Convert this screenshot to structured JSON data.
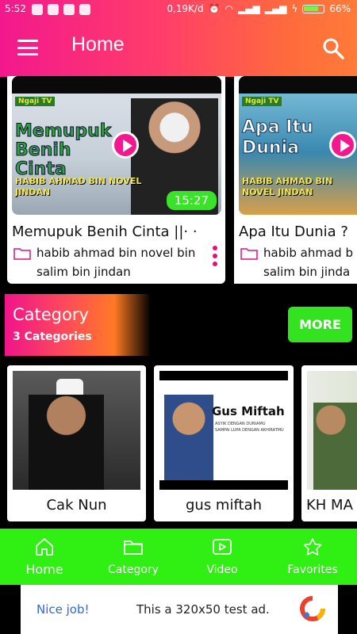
{
  "status_bar": {
    "time": "5:52",
    "net_speed": "0,19K/d",
    "battery": "66%"
  },
  "app_bar": {
    "title": "Home"
  },
  "videos": [
    {
      "thumb_text": "Memupuk Benih Cinta",
      "thumb_name": "HABIB AHMAD BIN NOVEL JINDAN",
      "duration": "15:27",
      "title": "Memupuk Benih Cinta ||· ·",
      "channel_line1": "habib ahmad bin novel bin",
      "channel_line2": "salim bin jindan",
      "brand": "Ngaji TV"
    },
    {
      "thumb_text": "Apa Itu Dunia",
      "thumb_name": "HABIB AHMAD BIN NOVEL JINDAN",
      "title": "Apa Itu Dunia ?",
      "channel_line1": "habib ahmad b",
      "channel_line2": "salim bin jinda",
      "brand": "Ngaji TV"
    }
  ],
  "category": {
    "title": "Category",
    "count": "3 Categories",
    "more": "MORE",
    "items": [
      {
        "label": "Cak Nun"
      },
      {
        "label": "gus miftah",
        "poster_title": "Gus Miftah",
        "poster_sub1": "ASYIK DENGAN DUNIAMU",
        "poster_sub2": "SAMPAI LUPA DENGAN AKHIRATMU"
      },
      {
        "label": "KH MA"
      }
    ]
  },
  "bottom_nav": [
    {
      "label": "Home"
    },
    {
      "label": "Category"
    },
    {
      "label": "Video"
    },
    {
      "label": "Favorites"
    }
  ],
  "ad": {
    "nice_job": "Nice job!",
    "text": "This a 320x50 test ad."
  },
  "colors": {
    "accent_pink": "#f3188d",
    "accent_green": "#33e31f"
  }
}
